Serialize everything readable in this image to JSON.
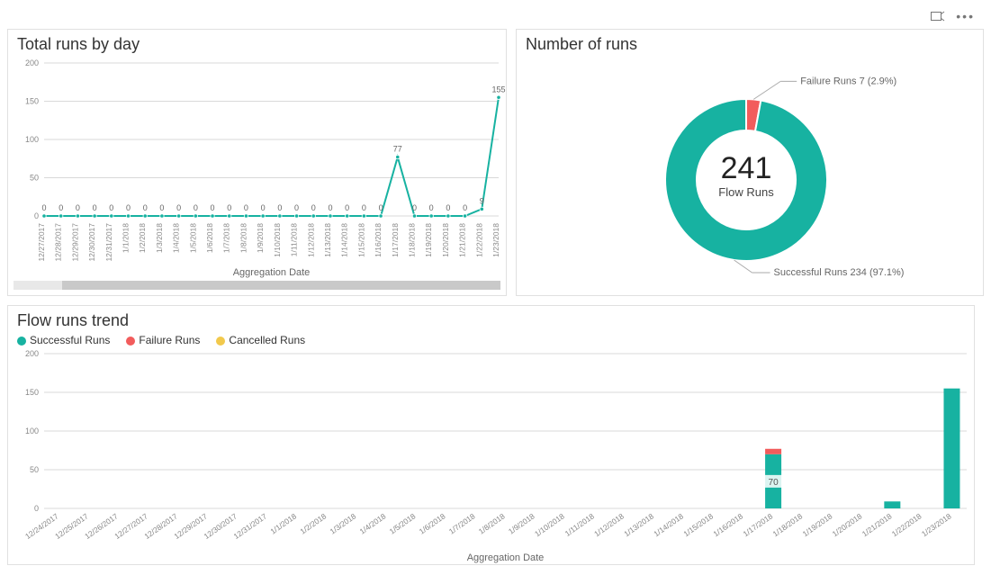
{
  "toolbar": {
    "share": "share",
    "more": "more"
  },
  "colors": {
    "teal": "#17b2a1",
    "red": "#f25c5c",
    "yellow": "#f2c94c",
    "grid": "#d9d9d9",
    "text": "#666"
  },
  "chart_data": [
    {
      "id": "total_runs_by_day",
      "type": "line",
      "title": "Total runs by day",
      "xlabel": "Aggregation Date",
      "ylabel": "",
      "ylim": [
        0,
        200
      ],
      "yticks": [
        0,
        50,
        100,
        150,
        200
      ],
      "categories": [
        "12/27/2017",
        "12/28/2017",
        "12/29/2017",
        "12/30/2017",
        "12/31/2017",
        "1/1/2018",
        "1/2/2018",
        "1/3/2018",
        "1/4/2018",
        "1/5/2018",
        "1/6/2018",
        "1/7/2018",
        "1/8/2018",
        "1/9/2018",
        "1/10/2018",
        "1/11/2018",
        "1/12/2018",
        "1/13/2018",
        "1/14/2018",
        "1/15/2018",
        "1/16/2018",
        "1/17/2018",
        "1/18/2018",
        "1/19/2018",
        "1/20/2018",
        "1/21/2018",
        "1/22/2018",
        "1/23/2018"
      ],
      "values": [
        0,
        0,
        0,
        0,
        0,
        0,
        0,
        0,
        0,
        0,
        0,
        0,
        0,
        0,
        0,
        0,
        0,
        0,
        0,
        0,
        0,
        77,
        0,
        0,
        0,
        0,
        9,
        155
      ],
      "show_point_labels": true
    },
    {
      "id": "number_of_runs",
      "type": "pie",
      "title": "Number of runs",
      "center_value": "241",
      "center_label": "Flow Runs",
      "slices": [
        {
          "name": "Successful Runs",
          "value": 234,
          "pct": "97.1%",
          "color_key": "teal"
        },
        {
          "name": "Failure Runs",
          "value": 7,
          "pct": "2.9%",
          "color_key": "red"
        }
      ]
    },
    {
      "id": "flow_runs_trend",
      "type": "bar",
      "title": "Flow runs trend",
      "xlabel": "Aggregation Date",
      "ylabel": "",
      "ylim": [
        0,
        200
      ],
      "yticks": [
        0,
        50,
        100,
        150,
        200
      ],
      "categories": [
        "12/24/2017",
        "12/25/2017",
        "12/26/2017",
        "12/27/2017",
        "12/28/2017",
        "12/29/2017",
        "12/30/2017",
        "12/31/2017",
        "1/1/2018",
        "1/2/2018",
        "1/3/2018",
        "1/4/2018",
        "1/5/2018",
        "1/6/2018",
        "1/7/2018",
        "1/8/2018",
        "1/9/2018",
        "1/10/2018",
        "1/11/2018",
        "1/12/2018",
        "1/13/2018",
        "1/14/2018",
        "1/15/2018",
        "1/16/2018",
        "1/17/2018",
        "1/18/2018",
        "1/19/2018",
        "1/20/2018",
        "1/21/2018",
        "1/22/2018",
        "1/23/2018"
      ],
      "series": [
        {
          "name": "Successful Runs",
          "color_key": "teal",
          "values": [
            0,
            0,
            0,
            0,
            0,
            0,
            0,
            0,
            0,
            0,
            0,
            0,
            0,
            0,
            0,
            0,
            0,
            0,
            0,
            0,
            0,
            0,
            0,
            0,
            70,
            0,
            0,
            0,
            9,
            0,
            155
          ]
        },
        {
          "name": "Failure Runs",
          "color_key": "red",
          "values": [
            0,
            0,
            0,
            0,
            0,
            0,
            0,
            0,
            0,
            0,
            0,
            0,
            0,
            0,
            0,
            0,
            0,
            0,
            0,
            0,
            0,
            0,
            0,
            0,
            7,
            0,
            0,
            0,
            0,
            0,
            0
          ]
        },
        {
          "name": "Cancelled Runs",
          "color_key": "yellow",
          "values": [
            0,
            0,
            0,
            0,
            0,
            0,
            0,
            0,
            0,
            0,
            0,
            0,
            0,
            0,
            0,
            0,
            0,
            0,
            0,
            0,
            0,
            0,
            0,
            0,
            0,
            0,
            0,
            0,
            0,
            0,
            0
          ]
        }
      ],
      "stack_label": {
        "index": 24,
        "text": "70"
      }
    }
  ]
}
